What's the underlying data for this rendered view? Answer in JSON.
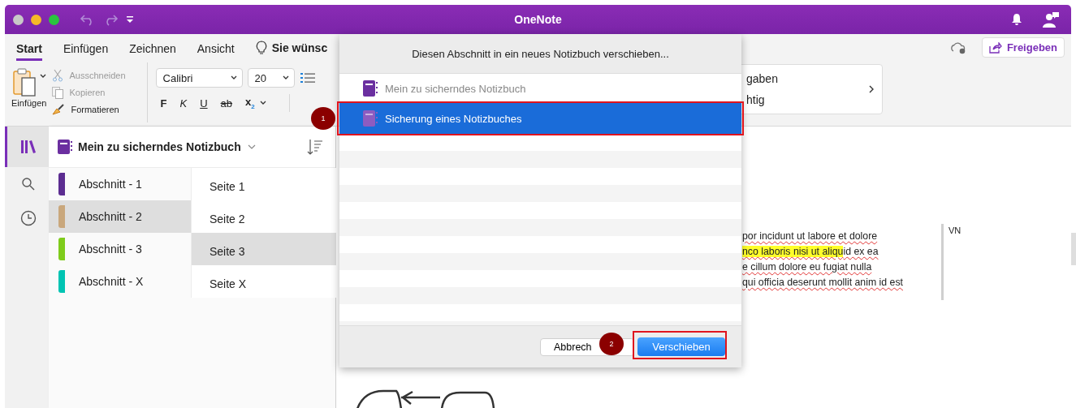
{
  "window": {
    "title": "OneNote"
  },
  "ribbon": {
    "tabs": [
      {
        "label": "Start",
        "selected": true
      },
      {
        "label": "Einfügen",
        "selected": false
      },
      {
        "label": "Zeichnen",
        "selected": false
      },
      {
        "label": "Ansicht",
        "selected": false
      }
    ],
    "tell_me": "Sie wünsc",
    "share_button": "Freigeben",
    "clipboard": {
      "paste": "Einfügen",
      "items": [
        {
          "kind": "cut",
          "label": "Ausschneiden",
          "disabled": true
        },
        {
          "kind": "copy",
          "label": "Kopieren",
          "disabled": true
        },
        {
          "kind": "format",
          "label": "Formatieren",
          "disabled": false
        }
      ]
    },
    "font": {
      "family": "Calibri",
      "size": "20"
    },
    "format_buttons": [
      {
        "kind": "bold",
        "label": "F"
      },
      {
        "kind": "italic",
        "label": "K"
      },
      {
        "kind": "underline",
        "label": "U"
      },
      {
        "kind": "strike",
        "label": "ab"
      },
      {
        "kind": "subscript",
        "label": "x$_{2}$"
      }
    ],
    "styles": [
      "gaben",
      "htig"
    ]
  },
  "rail": [
    {
      "kind": "notebooks",
      "selected": true
    },
    {
      "kind": "search",
      "selected": false
    },
    {
      "kind": "recent",
      "selected": false
    }
  ],
  "notebook": {
    "name": "Mein zu sicherndes Notizbuch"
  },
  "sections": [
    {
      "label": "Abschnitt - 1",
      "color": "#5c2d91",
      "selected": false
    },
    {
      "label": "Abschnitt - 2",
      "color": "#c9a77c",
      "selected": true
    },
    {
      "label": "Abschnitt - 3",
      "color": "#7fcc1c",
      "selected": false
    },
    {
      "label": "Abschnitt - X",
      "color": "#00c4b3",
      "selected": false
    }
  ],
  "pages": [
    {
      "label": "Seite 1",
      "selected": false
    },
    {
      "label": "Seite 2",
      "selected": false
    },
    {
      "label": "Seite 3",
      "selected": true
    },
    {
      "label": "Seite X",
      "selected": false
    }
  ],
  "note": {
    "lines": [
      [
        {
          "text": "por incidunt ut labore et dolore",
          "highlighted": false
        }
      ],
      [
        {
          "text": "nco laboris nisi ut aliqu",
          "highlighted": true
        },
        {
          "text": "id ex ea",
          "highlighted": false
        }
      ],
      [
        {
          "text": "e cillum dolore eu fugiat nulla",
          "highlighted": false
        }
      ],
      [
        {
          "text": "qui officia deserunt mollit anim id est",
          "highlighted": false
        }
      ]
    ],
    "author": "VN"
  },
  "dialog": {
    "title": "Diesen Abschnitt in ein neues Notizbuch verschieben...",
    "notebooks": [
      {
        "name": "Mein zu sicherndes Notizbuch",
        "selected": false,
        "disabled": true
      },
      {
        "name": "Sicherung eines Notizbuches",
        "selected": true,
        "disabled": false
      }
    ],
    "cancel": "Abbrech",
    "confirm": "Verschieben"
  },
  "annotations": [
    {
      "label": "1"
    },
    {
      "label": "2"
    }
  ]
}
